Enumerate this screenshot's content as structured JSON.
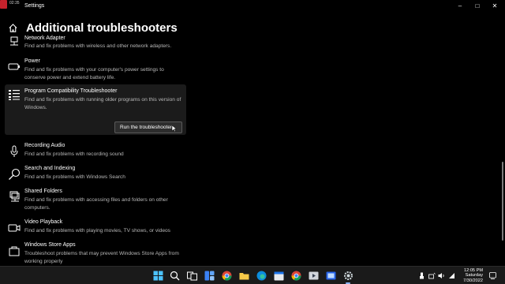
{
  "window": {
    "title": "Settings",
    "recording_time": "02:35",
    "controls": {
      "minimize": "–",
      "maximize": "□",
      "close": "✕"
    }
  },
  "page": {
    "title": "Additional troubleshooters"
  },
  "troubleshooters": [
    {
      "name": "Network Adapter",
      "description": "Find and fix problems with wireless and other network adapters.",
      "icon": "network-adapter-icon"
    },
    {
      "name": "Power",
      "description": "Find and fix problems with your computer's power settings to conserve power and extend battery life.",
      "icon": "battery-icon"
    },
    {
      "name": "Program Compatibility Troubleshooter",
      "description": "Find and fix problems with running older programs on this version of Windows.",
      "icon": "program-list-icon",
      "expanded": true,
      "action_label": "Run the troubleshooter"
    },
    {
      "name": "Recording Audio",
      "description": "Find and fix problems with recording sound",
      "icon": "microphone-icon"
    },
    {
      "name": "Search and Indexing",
      "description": "Find and fix problems with Windows Search",
      "icon": "search-icon"
    },
    {
      "name": "Shared Folders",
      "description": "Find and fix problems with accessing files and folders on other computers.",
      "icon": "shared-folders-icon"
    },
    {
      "name": "Video Playback",
      "description": "Find and fix problems with playing movies, TV shows, or videos",
      "icon": "video-icon"
    },
    {
      "name": "Windows Store Apps",
      "description": "Troubleshoot problems that may prevent Windows Store Apps from working properly",
      "icon": "store-icon"
    }
  ],
  "taskbar": {
    "apps": [
      "start-icon",
      "search-icon",
      "task-view-icon",
      "widgets-icon",
      "chrome-icon",
      "file-explorer-icon",
      "edge-icon",
      "calendar-icon",
      "chrome-icon",
      "app-icon",
      "app-icon",
      "settings-icon"
    ],
    "clock": {
      "time": "12:05 PM",
      "day": "Saturday",
      "date": "7/30/2022"
    },
    "accent": "#8ab4f8"
  }
}
